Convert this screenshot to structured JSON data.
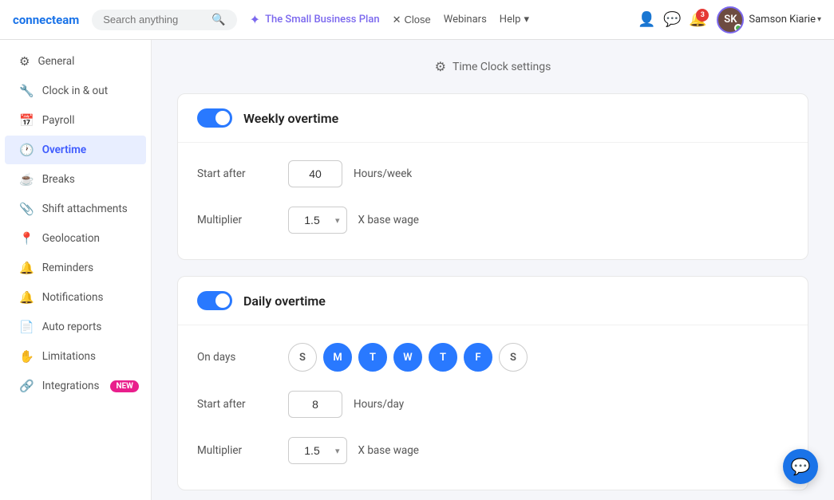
{
  "topnav": {
    "logo": "connecteam",
    "search_placeholder": "Search anything",
    "plan_label": "The Small Business Plan",
    "close_label": "Close",
    "webinars_label": "Webinars",
    "help_label": "Help",
    "bell_count": "3",
    "username": "Samson Kiarie",
    "avatar_initials": "SK"
  },
  "page_title": "Time Clock settings",
  "sidebar": {
    "items": [
      {
        "id": "general",
        "label": "General",
        "icon": "⚙",
        "active": false
      },
      {
        "id": "clock-in-out",
        "label": "Clock in & out",
        "icon": "🔧",
        "active": false
      },
      {
        "id": "payroll",
        "label": "Payroll",
        "icon": "📅",
        "active": false
      },
      {
        "id": "overtime",
        "label": "Overtime",
        "icon": "🕐",
        "active": true
      },
      {
        "id": "breaks",
        "label": "Breaks",
        "icon": "☕",
        "active": false
      },
      {
        "id": "shift-attachments",
        "label": "Shift attachments",
        "icon": "📎",
        "active": false
      },
      {
        "id": "geolocation",
        "label": "Geolocation",
        "icon": "📍",
        "active": false
      },
      {
        "id": "reminders",
        "label": "Reminders",
        "icon": "🔔",
        "active": false
      },
      {
        "id": "notifications",
        "label": "Notifications",
        "icon": "🔔",
        "active": false
      },
      {
        "id": "auto-reports",
        "label": "Auto reports",
        "icon": "📄",
        "active": false
      },
      {
        "id": "limitations",
        "label": "Limitations",
        "icon": "✋",
        "active": false
      },
      {
        "id": "integrations",
        "label": "Integrations",
        "icon": "🔗",
        "active": false,
        "badge": "NEW"
      }
    ]
  },
  "weekly_overtime": {
    "title": "Weekly overtime",
    "enabled": true,
    "start_after_label": "Start after",
    "start_after_value": "40",
    "start_after_unit": "Hours/week",
    "multiplier_label": "Multiplier",
    "multiplier_value": "1.5",
    "multiplier_unit": "X base wage"
  },
  "daily_overtime": {
    "title": "Daily overtime",
    "enabled": true,
    "on_days_label": "On days",
    "days": [
      {
        "letter": "S",
        "active": false
      },
      {
        "letter": "M",
        "active": true
      },
      {
        "letter": "T",
        "active": true
      },
      {
        "letter": "W",
        "active": true
      },
      {
        "letter": "T",
        "active": true
      },
      {
        "letter": "F",
        "active": true
      },
      {
        "letter": "S",
        "active": false
      }
    ],
    "start_after_label": "Start after",
    "start_after_value": "8",
    "start_after_unit": "Hours/day",
    "multiplier_label": "Multiplier",
    "multiplier_value": "1.5",
    "multiplier_unit": "X base wage"
  }
}
